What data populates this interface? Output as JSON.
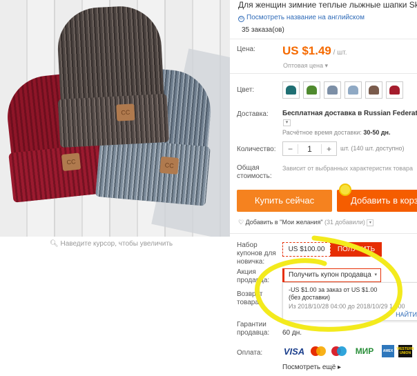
{
  "product": {
    "title": "Для женщин зимние теплые лыжные шапки Sku",
    "translate_link": "Посмотреть название на английском",
    "orders": "35 заказа(ов)",
    "zoom_hint": "Наведите курсор, чтобы увеличить"
  },
  "price": {
    "label": "Цена:",
    "value": "US $1.49",
    "unit": " / шт.",
    "wholesale": "Оптовая цена ▾"
  },
  "color": {
    "label": "Цвет:",
    "swatches": [
      "#1f6f73",
      "#4f8a2e",
      "#7c8fa6",
      "#8fa9c4",
      "#7a5b4c",
      "#a51d2d"
    ]
  },
  "shipping": {
    "label": "Доставка:",
    "method": "Бесплатная доставка в Russian Federation",
    "dropdown": "▾",
    "estimate_label": "Расчётное время доставки:",
    "estimate_value": "30-50 дн."
  },
  "quantity": {
    "label": "Количество:",
    "minus": "−",
    "value": "1",
    "plus": "+",
    "available": "шт. (140 шт. доступно)"
  },
  "total": {
    "label": "Общая\nстоимость:",
    "value": "Зависит от выбранных характеристик товара"
  },
  "actions": {
    "buy_now": "Купить сейчас",
    "add_to_cart": "Добавить в корзину"
  },
  "wishlist": {
    "text": "Добавить в \"Мои желания\"",
    "count": "(31 добавили)",
    "dropdown": "▾"
  },
  "coupons": {
    "new_user_label": "Набор купонов для новичка:",
    "new_user_value": "US $100.00",
    "get_button": "ПОЛУЧИТЬ",
    "seller_label": "Акция продавца:",
    "seller_select": "Получить купон продавца",
    "seller_caret": "▾",
    "return_label": "Возврат товара",
    "popup_line1": "-US $1.00 за заказ от US $1.00",
    "popup_line2": "(без доставки)",
    "popup_dates": "Из 2018/10/28 04:00 до 2018/10/29 14:00",
    "popup_find": "НАЙТИ"
  },
  "guarantee": {
    "label": "Гарантии продавца:",
    "value": "60 дн."
  },
  "payment": {
    "label": "Оплата:",
    "visa": "VISA",
    "mir": "МИР",
    "amex": "AMEX",
    "wu": "WESTERN UNION",
    "more": "Посмотреть ещё ▸"
  },
  "colors": {
    "accent_orange": "#f56a00",
    "coupon_red": "#e62e04",
    "link_blue": "#2f6bb8",
    "highlight_yellow": "#f3ea1d"
  }
}
